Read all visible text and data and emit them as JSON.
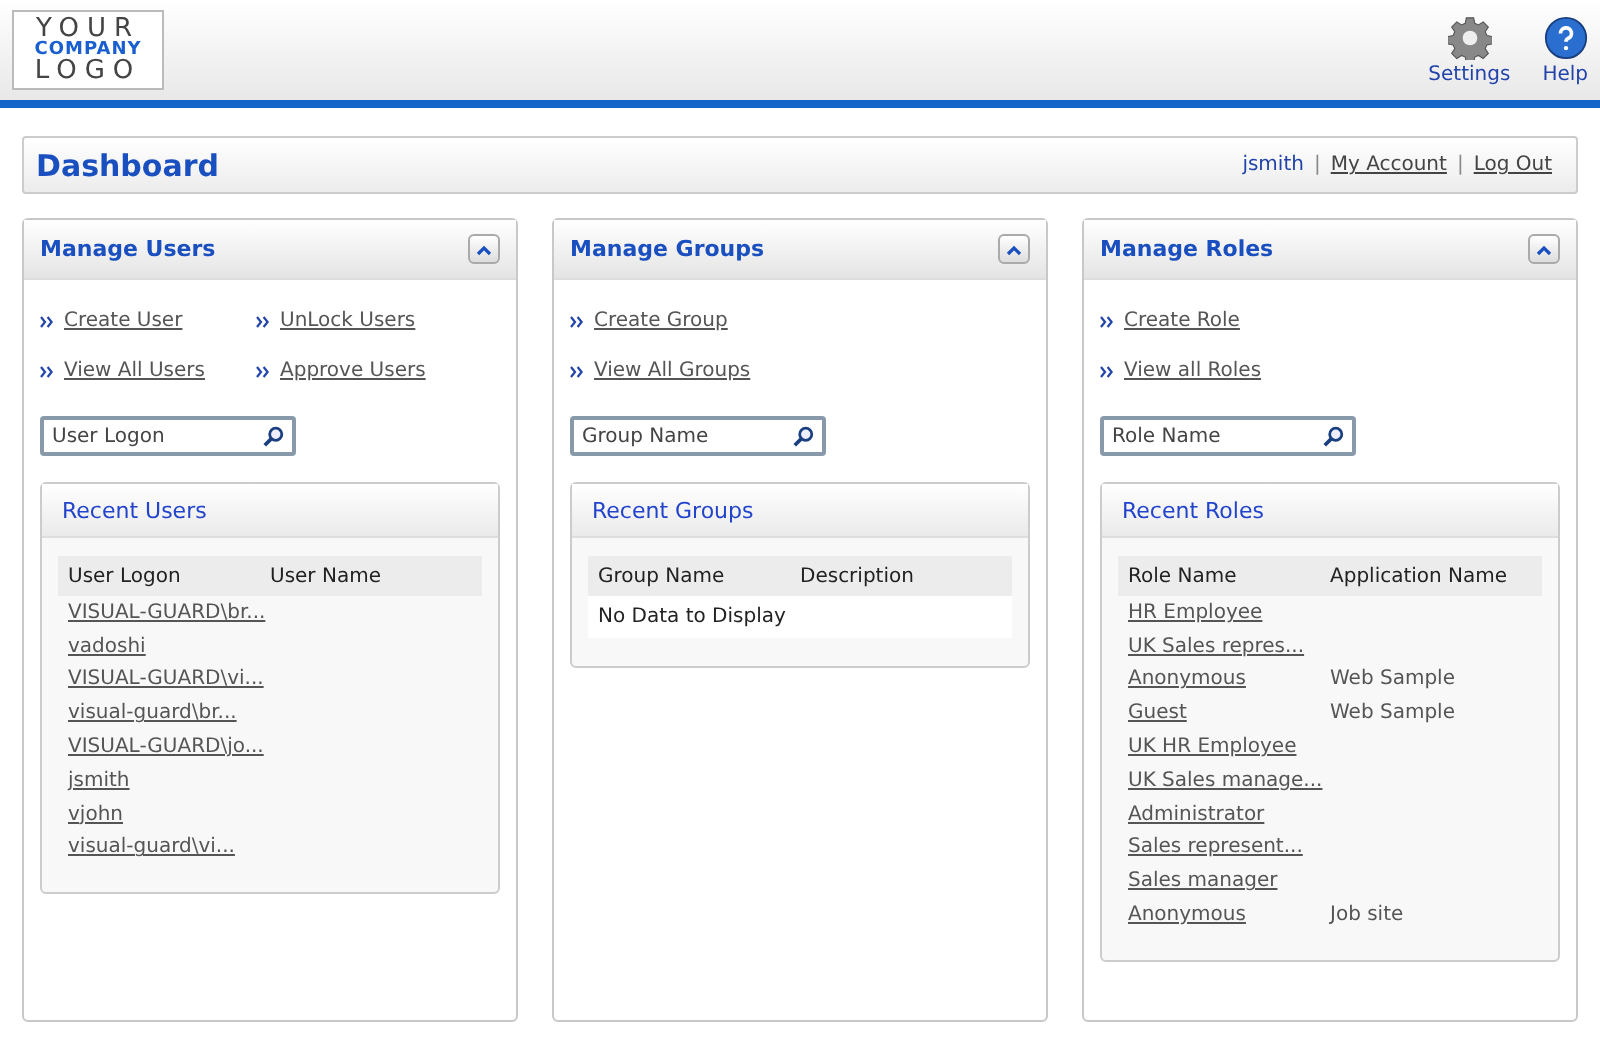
{
  "logo": {
    "lines": [
      "YOUR",
      "COMPANY",
      "LOGO"
    ]
  },
  "toolbar": [
    {
      "kind": "settings",
      "label": "Settings"
    },
    {
      "kind": "help",
      "label": "Help"
    }
  ],
  "dashboard": {
    "title": "Dashboard",
    "user": "jsmith",
    "separator": "|",
    "links": [
      "My Account",
      "Log Out"
    ]
  },
  "panels": [
    {
      "title": "Manage Users",
      "link_rows": [
        [
          "Create User",
          "UnLock Users"
        ],
        [
          "View All Users",
          "Approve Users"
        ]
      ],
      "search": {
        "placeholder": "User Logon"
      },
      "recent": {
        "title": "Recent Users",
        "columns": [
          "User Logon",
          "User Name"
        ],
        "rows": [
          [
            "VISUAL-GUARD\\br...",
            ""
          ],
          [
            "vadoshi",
            ""
          ],
          [
            "VISUAL-GUARD\\vi...",
            ""
          ],
          [
            "visual-guard\\br...",
            ""
          ],
          [
            "VISUAL-GUARD\\jo...",
            ""
          ],
          [
            "jsmith",
            ""
          ],
          [
            "vjohn",
            ""
          ],
          [
            "visual-guard\\vi...",
            ""
          ]
        ]
      }
    },
    {
      "title": "Manage Groups",
      "link_rows": [
        [
          "Create Group"
        ],
        [
          "View All Groups"
        ]
      ],
      "search": {
        "placeholder": "Group Name"
      },
      "recent": {
        "title": "Recent Groups",
        "columns": [
          "Group Name",
          "Description"
        ],
        "empty": "No Data to Display"
      }
    },
    {
      "title": "Manage Roles",
      "link_rows": [
        [
          "Create Role"
        ],
        [
          "View all Roles"
        ]
      ],
      "search": {
        "placeholder": "Role Name"
      },
      "recent": {
        "title": "Recent Roles",
        "columns": [
          "Role Name",
          "Application Name"
        ],
        "rows": [
          [
            "HR Employee",
            ""
          ],
          [
            "UK Sales repres...",
            ""
          ],
          [
            "Anonymous",
            "Web Sample"
          ],
          [
            "Guest",
            "Web Sample"
          ],
          [
            "UK HR Employee",
            ""
          ],
          [
            "UK Sales manage...",
            ""
          ],
          [
            "Administrator",
            ""
          ],
          [
            "Sales represent...",
            ""
          ],
          [
            "Sales manager",
            ""
          ],
          [
            "Anonymous",
            "Job site"
          ]
        ]
      }
    }
  ]
}
